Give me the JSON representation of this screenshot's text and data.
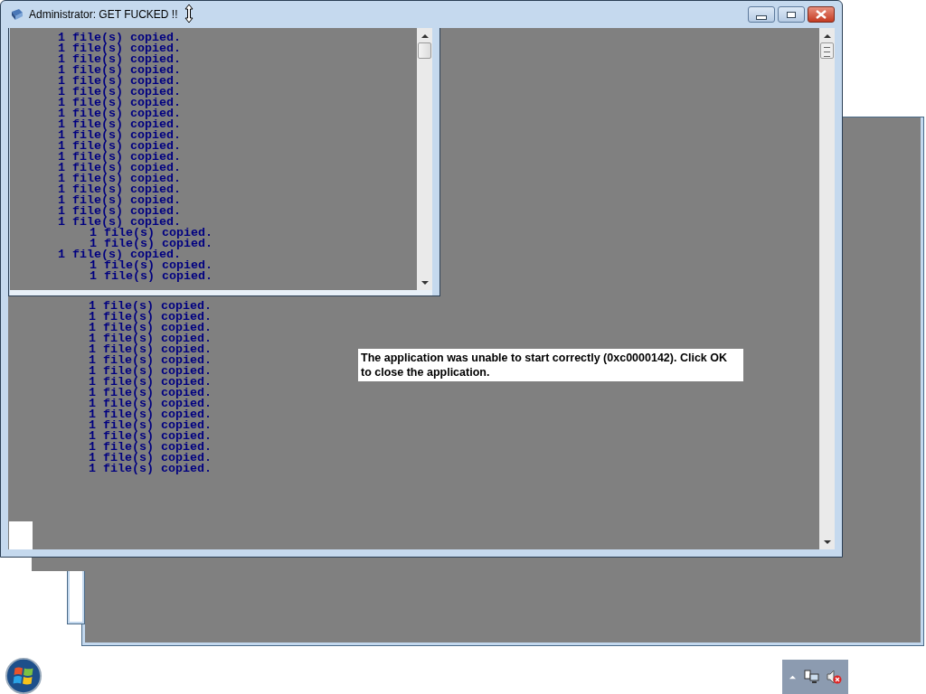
{
  "window": {
    "title": "Administrator:  GET FUCKED !!"
  },
  "inner_console": {
    "lines": [
      {
        "text": "1 file(s) copied.",
        "kind": "plain"
      },
      {
        "text": "1 file(s) copied.",
        "kind": "plain"
      },
      {
        "text": "1 file(s) copied.",
        "kind": "plain"
      },
      {
        "text": "1 file(s) copied.",
        "kind": "plain"
      },
      {
        "text": "1 file(s) copied.",
        "kind": "plain"
      },
      {
        "text": "1 file(s) copied.",
        "kind": "plain"
      },
      {
        "text": "1 file(s) copied.",
        "kind": "plain"
      },
      {
        "text": "1 file(s) copied.",
        "kind": "plain"
      },
      {
        "text": "1 file(s) copied.",
        "kind": "plain"
      },
      {
        "text": "1 file(s) copied.",
        "kind": "plain"
      },
      {
        "text": "1 file(s) copied.",
        "kind": "plain"
      },
      {
        "text": "1 file(s) copied.",
        "kind": "plain"
      },
      {
        "text": "1 file(s) copied.",
        "kind": "plain"
      },
      {
        "text": "1 file(s) copied.",
        "kind": "plain"
      },
      {
        "text": "1 file(s) copied.",
        "kind": "plain"
      },
      {
        "text": "1 file(s) copied.",
        "kind": "plain"
      },
      {
        "text": "1 file(s) copied.",
        "kind": "plain"
      },
      {
        "text": "1 file(s) copied.",
        "kind": "plain"
      },
      {
        "text": "1 file(s) copied.",
        "kind": "indented"
      },
      {
        "text": "1 file(s) copied.",
        "kind": "indented"
      },
      {
        "text": "1 file(s) copied.",
        "kind": "plain"
      },
      {
        "text": "1 file(s) copied.",
        "kind": "indented"
      },
      {
        "text": "1 file(s) copied.",
        "kind": "indented"
      }
    ]
  },
  "console": {
    "lines": [
      {
        "text": "1 file(s) copied.",
        "kind": "indented"
      },
      {
        "text": "1 file(s) copied.",
        "kind": "indented"
      },
      {
        "text": "1 file(s) copied.",
        "kind": "indented"
      },
      {
        "text": "1 file(s) copied.",
        "kind": "indented"
      },
      {
        "text": "1 file(s) copied.",
        "kind": "indented"
      },
      {
        "text": "1 file(s) copied.",
        "kind": "indented"
      },
      {
        "text": "1 file(s) copied.",
        "kind": "indented"
      },
      {
        "text": "1 file(s) copied.",
        "kind": "indented"
      },
      {
        "text": "1 file(s) copied.",
        "kind": "indented"
      },
      {
        "text": "1 file(s) copied.",
        "kind": "indented"
      },
      {
        "text": "1 file(s) copied.",
        "kind": "indented"
      },
      {
        "text": "1 file(s) copied.",
        "kind": "indented"
      },
      {
        "text": "1 file(s) copied.",
        "kind": "indented"
      },
      {
        "text": "1 file(s) copied.",
        "kind": "indented"
      },
      {
        "text": "1 file(s) copied.",
        "kind": "indented"
      },
      {
        "text": "1 file(s) copied.",
        "kind": "indented"
      }
    ]
  },
  "error_message": "The application was unable to start correctly (0xc0000142). Click OK to close the application."
}
